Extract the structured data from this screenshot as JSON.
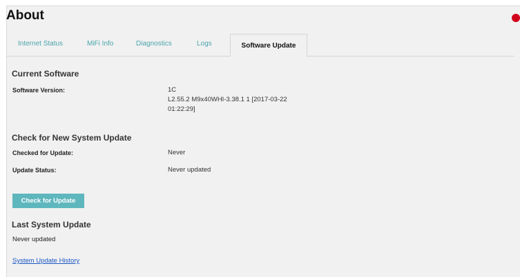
{
  "page": {
    "title": "About"
  },
  "tabs": [
    {
      "label": "Internet Status"
    },
    {
      "label": "MiFi Info"
    },
    {
      "label": "Diagnostics"
    },
    {
      "label": "Logs"
    },
    {
      "label": "Software Update",
      "active": true
    }
  ],
  "current_software": {
    "heading": "Current Software",
    "version_label": "Software Version:",
    "version_lines": [
      "1C",
      "L2.55.2 M9x40WHI-3.38.1 1 [2017-03-22",
      "01:22:29]"
    ]
  },
  "check_update": {
    "heading": "Check for New System Update",
    "checked_label": "Checked for Update:",
    "checked_value": "Never",
    "status_label": "Update Status:",
    "status_value": "Never updated",
    "button_label": "Check for Update"
  },
  "last_update": {
    "heading": "Last System Update",
    "value": "Never updated",
    "history_link": "System Update History"
  },
  "colors": {
    "accent": "#5fb7be",
    "tab_text": "#4aa4ac",
    "link": "#1a56c4",
    "notification": "#d0021b"
  }
}
